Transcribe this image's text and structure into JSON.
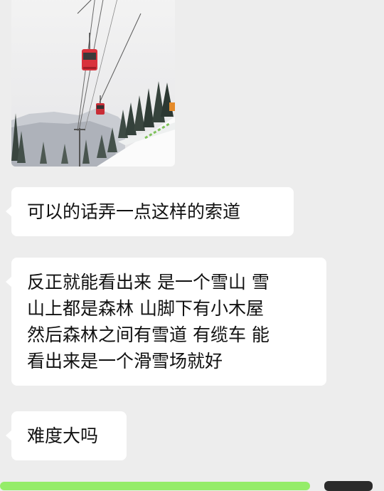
{
  "messages": {
    "image": {
      "kind": "photo",
      "subject": "ski-resort-cable-car"
    },
    "m1": {
      "text": "可以的话弄一点这样的索道"
    },
    "m2": {
      "lines": [
        "反正就能看出来 是一个雪山 雪",
        "山上都是森林 山脚下有小木屋",
        "然后森林之间有雪道 有缆车 能",
        "看出来是一个滑雪场就好"
      ]
    },
    "m3": {
      "text": "难度大吗"
    }
  },
  "colors": {
    "background": "#ededed",
    "incoming_bubble": "#ffffff",
    "outgoing_bubble": "#95ec69",
    "cable_car": "#d9323c"
  }
}
